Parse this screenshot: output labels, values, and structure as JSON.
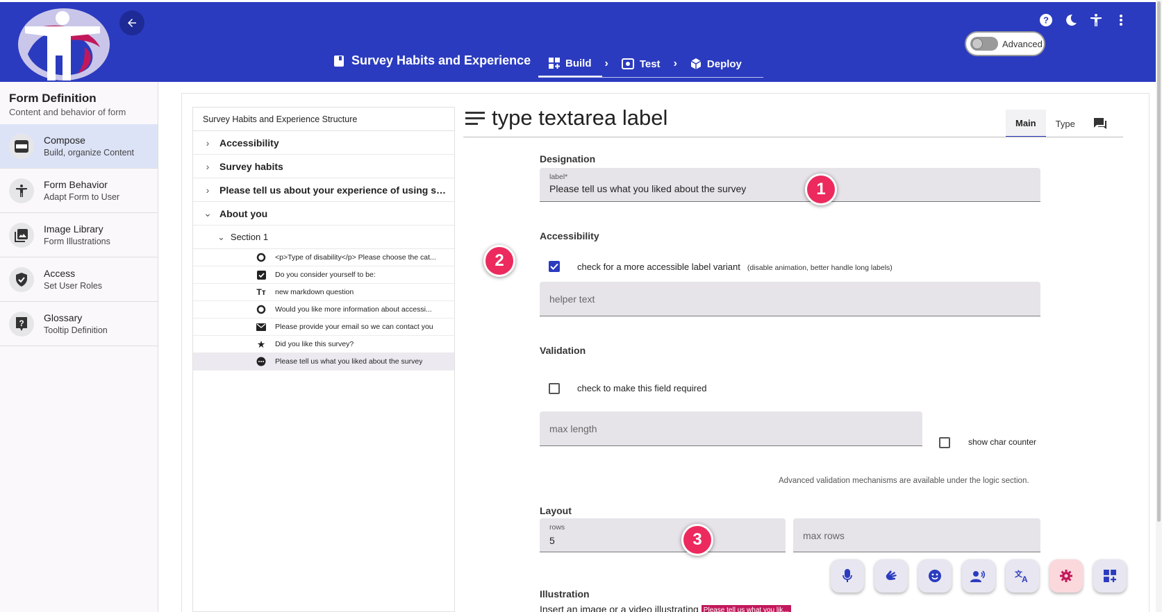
{
  "header": {
    "form_title": "Survey Habits and Experience",
    "steps": [
      {
        "label": "Build",
        "icon": "build-grid-icon"
      },
      {
        "label": "Test",
        "icon": "eye-icon"
      },
      {
        "label": "Deploy",
        "icon": "cube-icon"
      }
    ],
    "advanced_label": "Advanced",
    "colors": {
      "primary": "#2b3bbf",
      "accent": "#ec2a5e"
    }
  },
  "sidebar": {
    "title": "Form Definition",
    "subtitle": "Content and behavior of form",
    "items": [
      {
        "label": "Compose",
        "desc": "Build, organize Content",
        "icon": "compose-icon"
      },
      {
        "label": "Form Behavior",
        "desc": "Adapt Form to User",
        "icon": "accessibility-icon"
      },
      {
        "label": "Image Library",
        "desc": "Form Illustrations",
        "icon": "image-icon"
      },
      {
        "label": "Access",
        "desc": "Set User Roles",
        "icon": "shield-icon"
      },
      {
        "label": "Glossary",
        "desc": "Tooltip Definition",
        "icon": "help-icon"
      }
    ]
  },
  "tree": {
    "title": "Survey Habits and Experience Structure",
    "pages": [
      "Accessibility",
      "Survey habits",
      "Please tell us about your experience of using su...",
      "About you"
    ],
    "section": "Section 1",
    "questions": [
      {
        "text": "<p>Type of disability</p> Please choose the cat...",
        "icon": "radio-icon"
      },
      {
        "text": "Do you consider yourself to be:",
        "icon": "checkbox-icon"
      },
      {
        "text": "new markdown question",
        "icon": "text-format-icon"
      },
      {
        "text": "Would you like more information about accessi...",
        "icon": "radio-icon"
      },
      {
        "text": "Please provide your email so we can contact you",
        "icon": "email-icon"
      },
      {
        "text": "Did you like this survey?",
        "icon": "star-icon"
      },
      {
        "text": "Please tell us what you liked about the survey",
        "icon": "textarea-icon"
      }
    ]
  },
  "editor": {
    "title": "type textarea label",
    "tabs": [
      "Main",
      "Type"
    ],
    "designation": {
      "heading": "Designation",
      "label_caption": "label*",
      "label_value": "Please tell us what you liked about the survey"
    },
    "accessibility": {
      "heading": "Accessibility",
      "check_label": "check for a more accessible label variant",
      "check_hint": "(disable animation, better handle long labels)",
      "helper_placeholder": "helper text"
    },
    "validation": {
      "heading": "Validation",
      "required_label": "check to make this field required",
      "max_length_placeholder": "max length",
      "char_counter_label": "show char counter",
      "note": "Advanced validation mechanisms are available under the logic section."
    },
    "layout": {
      "heading": "Layout",
      "rows_caption": "rows",
      "rows_value": "5",
      "max_rows_placeholder": "max rows"
    },
    "illustration": {
      "heading": "Illustration",
      "text": "Insert an image or a video illustrating",
      "chip": "Please tell us what you lik..."
    }
  },
  "badges": [
    "1",
    "2",
    "3"
  ],
  "fabs": [
    "mic-icon",
    "sign-language-icon",
    "emoji-icon",
    "voice-person-icon",
    "translate-icon",
    "settings-icon",
    "add-widget-icon"
  ]
}
